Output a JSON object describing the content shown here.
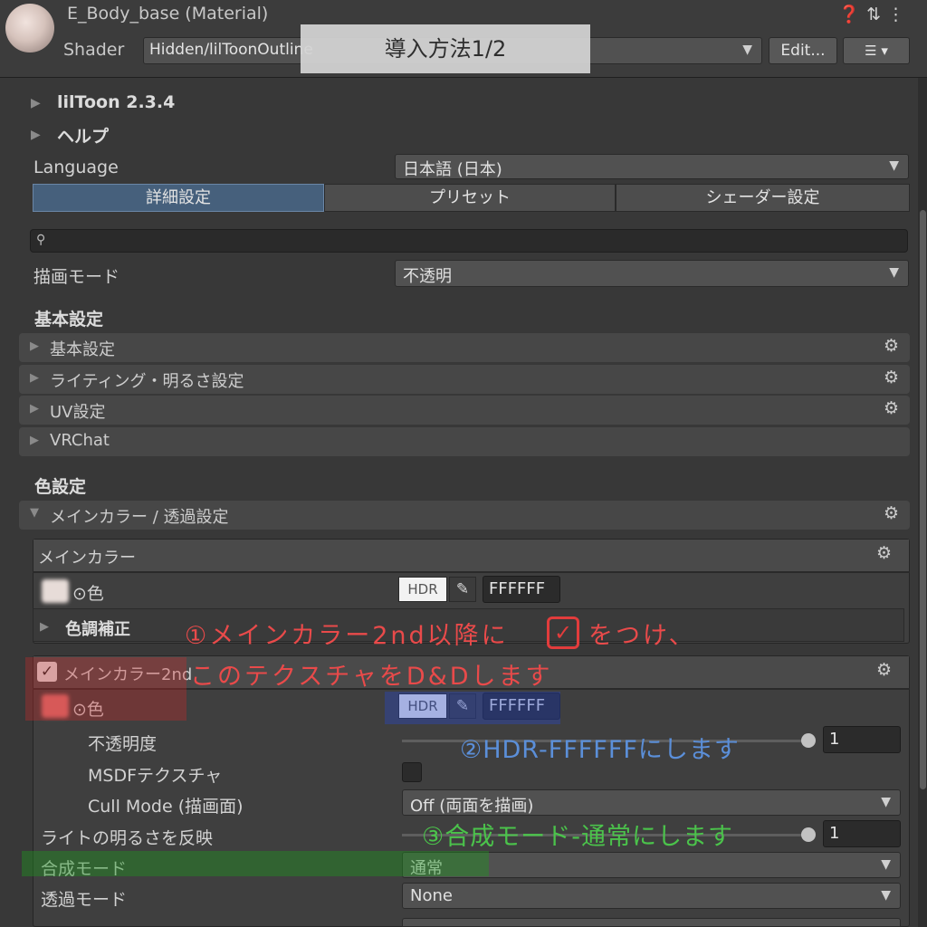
{
  "header": {
    "title": "E_Body_base (Material)",
    "icons": [
      "help-icon",
      "preset-sliders-icon",
      "more-vertical-icon"
    ],
    "shader_label": "Shader",
    "shader_value": "Hidden/lilToonOutline",
    "edit_label": "Edit...",
    "menu_glyph": "☰ ▾"
  },
  "banner": {
    "text": "導入方法1/2"
  },
  "foldouts": {
    "version": "lilToon 2.3.4",
    "help": "ヘルプ"
  },
  "language": {
    "label": "Language",
    "value": "日本語 (日本)"
  },
  "tabs": [
    {
      "label": "詳細設定",
      "active": true
    },
    {
      "label": "プリセット",
      "active": false
    },
    {
      "label": "シェーダー設定",
      "active": false
    }
  ],
  "search": {
    "placeholder": ""
  },
  "render_mode": {
    "label": "描画モード",
    "value": "不透明"
  },
  "basic_section": {
    "heading": "基本設定",
    "items": [
      "基本設定",
      "ライティング・明るさ設定",
      "UV設定",
      "VRChat"
    ]
  },
  "color_section": {
    "heading": "色設定",
    "main_bar": "メインカラー / 透過設定"
  },
  "main_color": {
    "title": "メインカラー",
    "color_label": "⊙色",
    "hdr": "HDR",
    "hex": "FFFFFF",
    "tone_label": "色調補正"
  },
  "main_color_2nd": {
    "title": "メインカラー2nd",
    "color_label": "⊙色",
    "hdr": "HDR",
    "hex": "FFFFFF",
    "opacity_label": "不透明度",
    "opacity_value": "1",
    "msdf_label": "MSDFテクスチャ",
    "cull_label": "Cull Mode (描画面)",
    "cull_value": "Off (両面を描画)",
    "light_label": "ライトの明るさを反映",
    "light_value": "1",
    "blend_label": "合成モード",
    "blend_value": "通常",
    "alpha_label": "透過モード",
    "alpha_value": "None"
  },
  "annotations": {
    "step1_line1a": "①メインカラー2nd以降に",
    "step1_check": "✓",
    "step1_line1b": "をつけ、",
    "step1_line2": "このテクスチャをD&Dします",
    "step2": "②HDR-FFFFFFにします",
    "step3": "③合成モード-通常にします"
  },
  "colors": {
    "panel_bg": "#383838",
    "active_tab": "#46607c",
    "annotation_red": "#e94a4a",
    "annotation_blue": "#5b8fd9",
    "annotation_green": "#4bc34b"
  }
}
